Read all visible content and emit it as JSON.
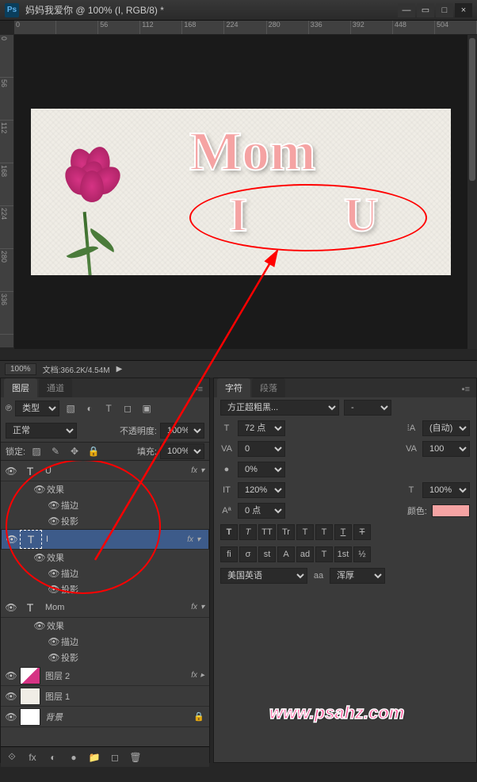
{
  "titlebar": {
    "title": "妈妈我爱你 @ 100% (I, RGB/8) *",
    "logo": "Ps"
  },
  "win": {
    "min": "—",
    "square": "▭",
    "max": "□",
    "close": "×"
  },
  "ruler_h": [
    "0",
    "",
    "56",
    "112",
    "168",
    "224",
    "280",
    "336",
    "392",
    "448",
    "504"
  ],
  "ruler_v": [
    "0",
    "56",
    "112",
    "168",
    "224",
    "280",
    "336"
  ],
  "canvas": {
    "mom": "Mom",
    "i": "I",
    "u": "U"
  },
  "status": {
    "zoom": "100%",
    "doc": "文档:366.2K/4.54M",
    "arrow": "▶"
  },
  "layers_panel": {
    "tab1": "图层",
    "tab2": "通道",
    "menu": "▪≡",
    "kind": "类型",
    "blend": "正常",
    "opacity_lbl": "不透明度:",
    "opacity": "100%",
    "lock_lbl": "锁定:",
    "fill_lbl": "填充:",
    "fill": "100%",
    "items": {
      "u": "U",
      "i": "I",
      "mom": "Mom",
      "eff": "效果",
      "stroke": "描边",
      "shadow": "投影",
      "l2": "图层 2",
      "l1": "图层 1",
      "bg": "背景"
    },
    "fx": "fx",
    "down": "▾",
    "link": "⟐",
    "lock": "🔒",
    "bb": {
      "link": "⟐",
      "fx": "fx",
      "mask": "◐",
      "adj": "●",
      "folder": "📁",
      "new": "◻",
      "trash": "🗑"
    }
  },
  "char_panel": {
    "tab1": "字符",
    "tab2": "段落",
    "menu": "▪≡",
    "font": "方正超粗黑...",
    "style": "-",
    "size": "72 点",
    "leading": "(自动)",
    "sizei": "T",
    "leadi": "⁞A",
    "va": "0",
    "tracking": "100",
    "vai": "VA",
    "tracki": "VA",
    "scale": "0%",
    "scalei": "●",
    "vscale": "120%",
    "hscale": "100%",
    "vi": "IT",
    "hi": "T",
    "baseline": "0 点",
    "bi": "Aª",
    "color_lbl": "颜色:",
    "styles": [
      "T",
      "T",
      "TT",
      "Tr",
      "T",
      "T",
      "T",
      "T"
    ],
    "ot": [
      "fi",
      "σ",
      "st",
      "A",
      "ad",
      "T",
      "1st",
      "½"
    ],
    "lang": "美国英语",
    "aa": "aa",
    "aa_val": "浑厚"
  },
  "watermark": "www.psahz.com"
}
